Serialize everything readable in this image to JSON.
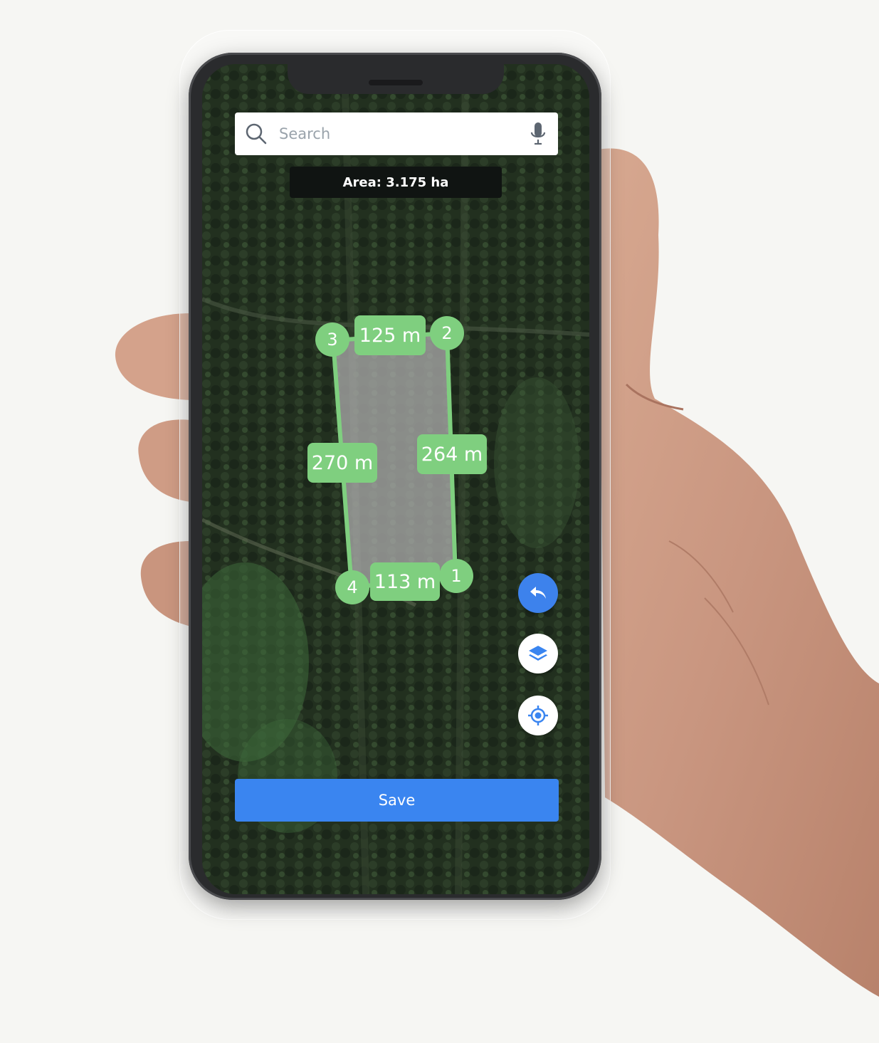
{
  "search": {
    "placeholder": "Search"
  },
  "area": {
    "label": "Area: 3.175 ha"
  },
  "vertices": [
    "1",
    "2",
    "3",
    "4"
  ],
  "edges": {
    "top": "125 m",
    "right": "264 m",
    "left": "270 m",
    "bottom": "113 m"
  },
  "actions": {
    "save_label": "Save"
  },
  "icons": {
    "search": "search-icon",
    "mic": "microphone-icon",
    "undo": "undo-icon",
    "layers": "layers-icon",
    "locate": "locate-icon"
  },
  "colors": {
    "accent": "#3a85f0",
    "polygon": "#7fcf7f",
    "banner": "#101412"
  }
}
